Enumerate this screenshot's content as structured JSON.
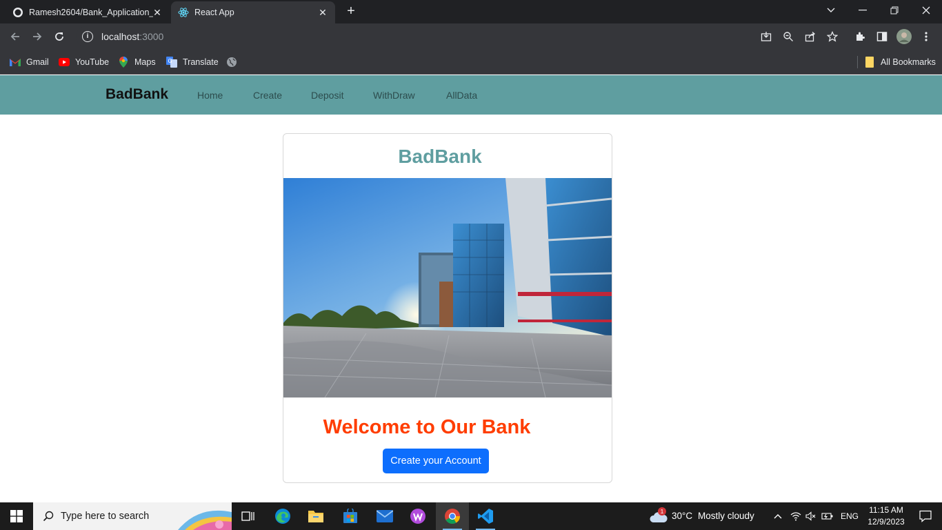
{
  "browser": {
    "tabs": [
      {
        "title": "Ramesh2604/Bank_Application_",
        "icon": "github-icon"
      },
      {
        "title": "React App",
        "icon": "react-icon"
      }
    ],
    "url_host": "localhost",
    "url_port": ":3000",
    "bookmarks": [
      {
        "label": "Gmail",
        "icon": "gmail-icon"
      },
      {
        "label": "YouTube",
        "icon": "youtube-icon"
      },
      {
        "label": "Maps",
        "icon": "maps-icon"
      },
      {
        "label": "Translate",
        "icon": "translate-icon"
      }
    ],
    "all_bookmarks": "All Bookmarks"
  },
  "navbar": {
    "brand": "BadBank",
    "links": [
      "Home",
      "Create",
      "Deposit",
      "WithDraw",
      "AllData"
    ]
  },
  "card": {
    "title": "BadBank",
    "image": "bank-building-photo",
    "welcome": "Welcome to Our Bank",
    "button": "Create your Account"
  },
  "taskbar": {
    "search_placeholder": "Type here to search",
    "weather_temp": "30°C",
    "weather_desc": "Mostly cloudy",
    "weather_badge": "1",
    "language": "ENG",
    "time": "11:15 AM",
    "date": "12/9/2023"
  },
  "colors": {
    "navbar": "#5f9ea0",
    "title": "#5f9ea0",
    "welcome": "#ff3d00",
    "button": "#0d6efd"
  }
}
